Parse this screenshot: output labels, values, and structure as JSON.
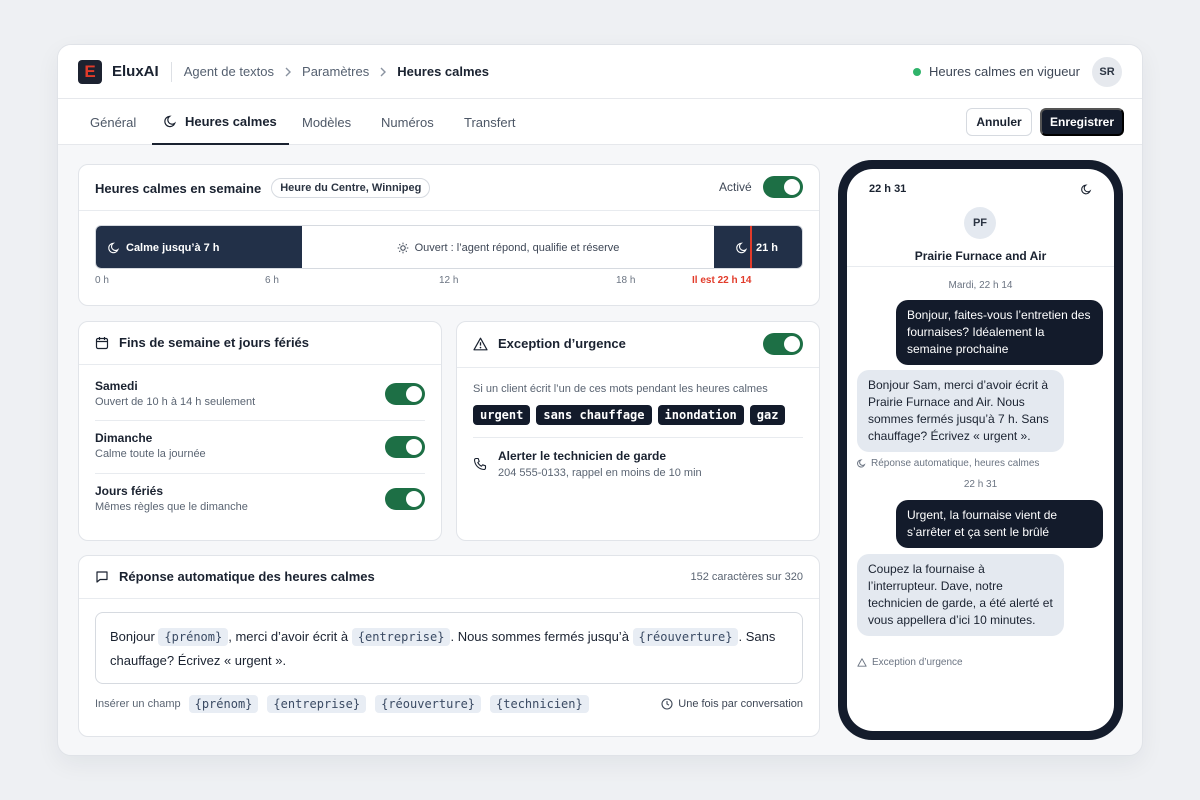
{
  "app": {
    "logo_letter": "E",
    "brand": "EluxAI"
  },
  "breadcrumb": [
    "Agent de textos",
    "Paramètres",
    "Heures calmes"
  ],
  "status": {
    "text": "Heures calmes en vigueur",
    "color": "#2fb36a"
  },
  "user": {
    "initials": "SR"
  },
  "tabs": [
    "Général",
    "Heures calmes",
    "Modèles",
    "Numéros",
    "Transfert"
  ],
  "actions": {
    "cancel": "Annuler",
    "save": "Enregistrer"
  },
  "weekday": {
    "title": "Heures calmes en semaine",
    "timezone": "Heure du Centre, Winnipeg",
    "toggle_label": "Activé",
    "calm_morning": "Calme jusqu’à 7 h",
    "open_label": "Ouvert : l’agent répond, qualifie et réserve",
    "calm_evening": "21 h",
    "ticks": [
      "0 h",
      "6 h",
      "12 h",
      "18 h"
    ],
    "now_label": "Il est 22 h 14",
    "now_color": "#e23b2a"
  },
  "weekends": {
    "title": "Fins de semaine et jours fériés",
    "items": [
      {
        "title": "Samedi",
        "subtitle": "Ouvert de 10 h à 14 h seulement"
      },
      {
        "title": "Dimanche",
        "subtitle": "Calme toute la journée"
      },
      {
        "title": "Jours fériés",
        "subtitle": "Mêmes règles que le dimanche"
      }
    ]
  },
  "emergency": {
    "title": "Exception d’urgence",
    "hint": "Si un client écrit l’un de ces mots pendant les heures calmes",
    "keywords": [
      "urgent",
      "sans chauffage",
      "inondation",
      "gaz"
    ],
    "alert_title": "Alerter le technicien de garde",
    "alert_detail": "204 555-0133, rappel en moins de 10 min"
  },
  "autoreply": {
    "title": "Réponse automatique des heures calmes",
    "count": "152 caractères sur 320",
    "message": {
      "t1": "Bonjour ",
      "v1": "{prénom}",
      "t2": ", merci d’avoir écrit à ",
      "v2": "{entreprise}",
      "t3": ". Nous sommes fermés jusqu’à ",
      "v3": "{réouverture}",
      "t4": ". Sans chauffage? Écrivez « urgent »."
    },
    "insert_label": "Insérer un champ",
    "fields": [
      "{prénom}",
      "{entreprise}",
      "{réouverture}",
      "{technicien}"
    ],
    "frequency": "Une fois par conversation"
  },
  "phone": {
    "time": "22 h 31",
    "contact_initials": "PF",
    "contact_name": "Prairie Furnace and Air",
    "day_label": "Mardi, 22 h 14",
    "msg1": "Bonjour, faites-vous l’entretien des fournaises? Idéalement la semaine prochaine",
    "msg2": "Bonjour Sam, merci d’avoir écrit à Prairie Furnace and Air. Nous sommes fermés jusqu’à 7 h. Sans chauffage? Écrivez « urgent ».",
    "msg2_note": "Réponse automatique, heures calmes",
    "time2": "22 h 31",
    "msg3": "Urgent, la fournaise vient de s’arrêter et ça sent le brûlé",
    "msg4": "Coupez la fournaise à l’interrupteur. Dave, notre technicien de garde, a été alerté et vous appellera d’ici 10 minutes.",
    "msg4_note": "Exception d’urgence"
  }
}
